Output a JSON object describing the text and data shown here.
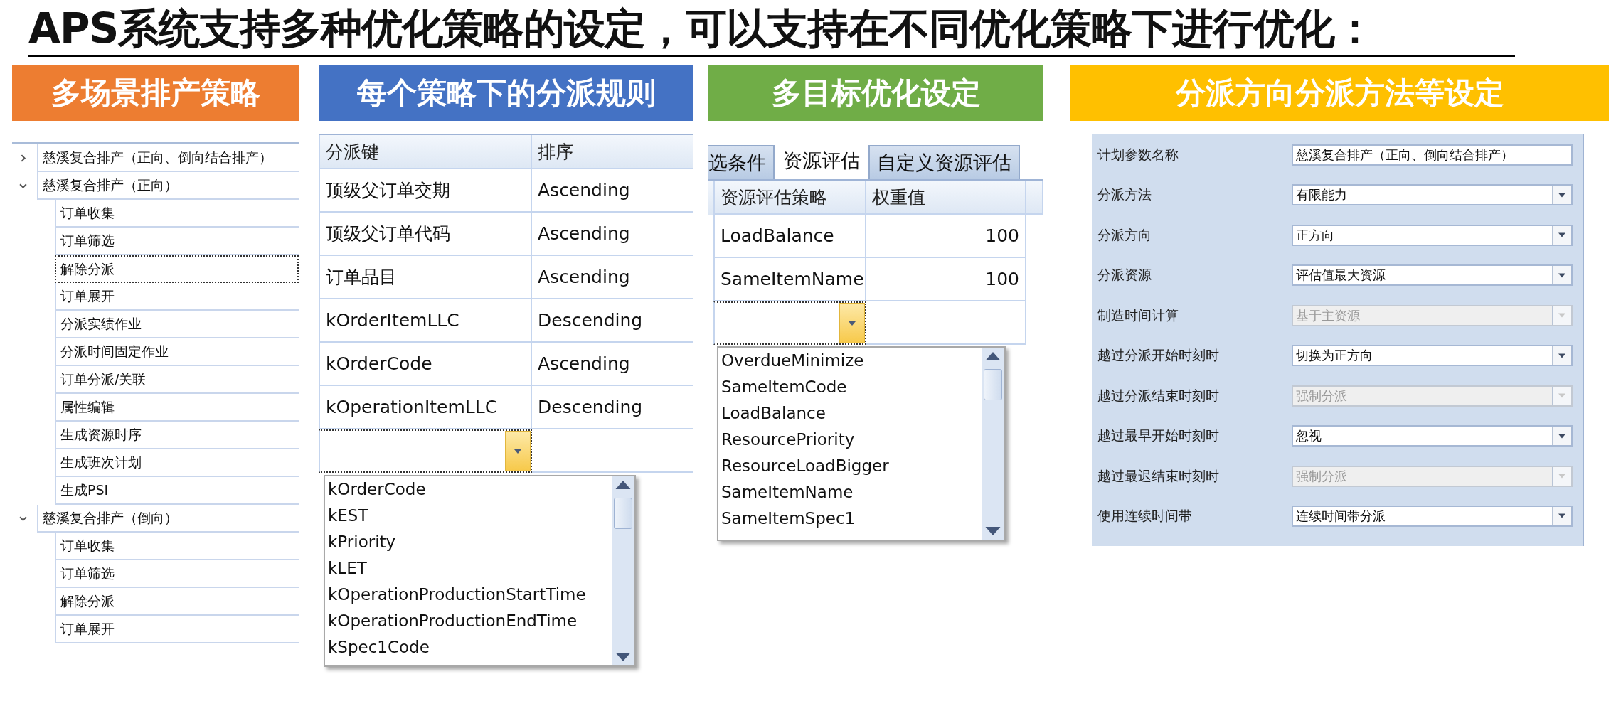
{
  "title": "APS系统支持多种优化策略的设定，可以支持在不同优化策略下进行优化：",
  "sections": [
    {
      "heading": "多场景排产策略",
      "color": "#ed7d31"
    },
    {
      "heading": "每个策略下的分派规则",
      "color": "#4472c4"
    },
    {
      "heading": "多目标优化设定",
      "color": "#70ad47"
    },
    {
      "heading": "分派方向分派方法等设定",
      "color": "#ffc000"
    }
  ],
  "strategy_tree": {
    "items": [
      {
        "label": "慈溪复合排产（正向、倒向结合排产）",
        "expanded": false,
        "selected": false
      },
      {
        "label": "慈溪复合排产（正向）",
        "expanded": true,
        "selected": false,
        "children": [
          {
            "label": "订单收集",
            "selected": false
          },
          {
            "label": "订单筛选",
            "selected": false
          },
          {
            "label": "解除分派",
            "selected": true
          },
          {
            "label": "订单展开",
            "selected": false
          },
          {
            "label": "分派实绩作业",
            "selected": false
          },
          {
            "label": "分派时间固定作业",
            "selected": false
          },
          {
            "label": "订单分派/关联",
            "selected": false
          },
          {
            "label": "属性编辑",
            "selected": false
          },
          {
            "label": "生成资源时序",
            "selected": false
          },
          {
            "label": "生成班次计划",
            "selected": false
          },
          {
            "label": "生成PSI",
            "selected": false
          }
        ]
      },
      {
        "label": "慈溪复合排产（倒向）",
        "expanded": true,
        "selected": false,
        "children": [
          {
            "label": "订单收集",
            "selected": false
          },
          {
            "label": "订单筛选",
            "selected": false
          },
          {
            "label": "解除分派",
            "selected": false
          },
          {
            "label": "订单展开",
            "selected": false
          }
        ]
      }
    ]
  },
  "dispatch_rules": {
    "columns": [
      "分派键",
      "排序"
    ],
    "rows": [
      {
        "key": "顶级父订单交期",
        "order": "Ascending"
      },
      {
        "key": "顶级父订单代码",
        "order": "Ascending"
      },
      {
        "key": "订单品目",
        "order": "Ascending"
      },
      {
        "key": "kOrderItemLLC",
        "order": "Descending"
      },
      {
        "key": "kOrderCode",
        "order": "Ascending"
      },
      {
        "key": "kOperationItemLLC",
        "order": "Descending"
      }
    ],
    "dropdown": {
      "options": [
        "kOrderCode",
        "kEST",
        "kPriority",
        "kLET",
        "kOperationProductionStartTime",
        "kOperationProductionEndTime",
        "kSpec1Code"
      ]
    }
  },
  "objectives": {
    "tabs": [
      {
        "label": "选条件",
        "selected": false
      },
      {
        "label": "资源评估",
        "selected": true
      },
      {
        "label": "自定义资源评估",
        "selected": false
      }
    ],
    "columns": [
      "资源评估策略",
      "权重值"
    ],
    "rows": [
      {
        "strategy": "LoadBalance",
        "weight": "100"
      },
      {
        "strategy": "SameItemName",
        "weight": "100"
      }
    ],
    "dropdown": {
      "options": [
        "OverdueMinimize",
        "SameItemCode",
        "LoadBalance",
        "ResourcePriority",
        "ResourceLoadBigger",
        "SameItemName",
        "SameItemSpec1"
      ]
    }
  },
  "settings": {
    "fields": [
      {
        "label": "计划参数名称",
        "kind": "text",
        "value": "慈溪复合排产（正向、倒向结合排产）",
        "disabled": false
      },
      {
        "label": "分派方法",
        "kind": "select",
        "value": "有限能力",
        "disabled": false
      },
      {
        "label": "分派方向",
        "kind": "select",
        "value": "正方向",
        "disabled": false
      },
      {
        "label": "分派资源",
        "kind": "select",
        "value": "评估值最大资源",
        "disabled": false
      },
      {
        "label": "制造时间计算",
        "kind": "select",
        "value": "基于主资源",
        "disabled": true
      },
      {
        "label": "越过分派开始时刻时",
        "kind": "select",
        "value": "切换为正方向",
        "disabled": false
      },
      {
        "label": "越过分派结束时刻时",
        "kind": "select",
        "value": "强制分派",
        "disabled": true
      },
      {
        "label": "越过最早开始时刻时",
        "kind": "select",
        "value": "忽视",
        "disabled": false
      },
      {
        "label": "越过最迟结束时刻时",
        "kind": "select",
        "value": "强制分派",
        "disabled": true
      },
      {
        "label": "使用连续时间带",
        "kind": "select",
        "value": "连续时间带分派",
        "disabled": false
      }
    ]
  }
}
